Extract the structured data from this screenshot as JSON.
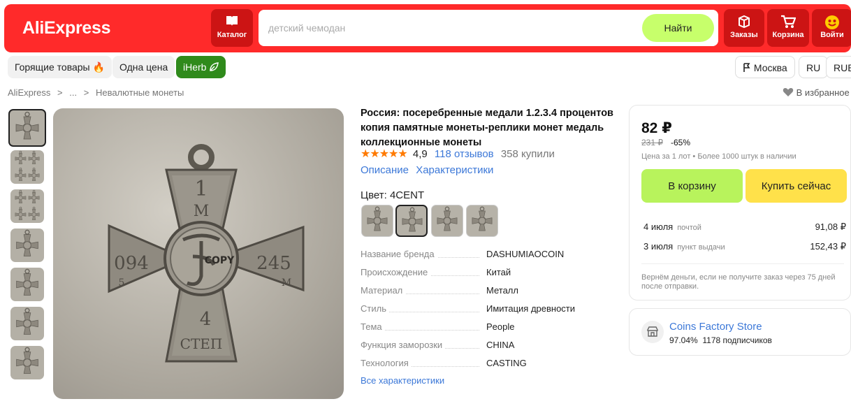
{
  "header": {
    "logo": "AliExpress",
    "catalog_label": "Каталог",
    "search_placeholder": "детский чемодан",
    "search_button": "Найти",
    "orders_label": "Заказы",
    "cart_label": "Корзина",
    "login_label": "Войти"
  },
  "nav": {
    "hot_deals": "Горящие товары",
    "one_price": "Одна цена",
    "iherb": "iHerb",
    "city": "Москва",
    "language": "RU",
    "currency": "RUB"
  },
  "breadcrumb": [
    "AliExpress",
    ">",
    "...",
    ">",
    "Невалютные монеты"
  ],
  "favorites_label": "В избранное",
  "product": {
    "title": "Россия: посеребренные медали 1.2.3.4 процентов копия памятные монеты-реплики монет медаль коллекционные монеты",
    "stars": "★★★★★",
    "rating": "4,9",
    "reviews": "118 отзывов",
    "bought": "358 купили",
    "tabs": [
      "Описание",
      "Характеристики"
    ],
    "color_label": "Цвет: 4CENT",
    "specs": [
      {
        "key": "Название бренда",
        "value": "DASHUMIAOCOIN"
      },
      {
        "key": "Происхождение",
        "value": "Китай"
      },
      {
        "key": "Материал",
        "value": "Металл"
      },
      {
        "key": "Стиль",
        "value": "Имитация древности"
      },
      {
        "key": "Тема",
        "value": "People"
      },
      {
        "key": "Функция заморозки",
        "value": "CHINA"
      },
      {
        "key": "Технология",
        "value": "CASTING"
      }
    ],
    "all_specs_link": "Все характеристики",
    "image_text": {
      "top": "1",
      "top2": "М",
      "left": "094",
      "left_small": "5",
      "right": "245",
      "right_small": "М",
      "bottom": "4",
      "bottom2": "СТЕП",
      "stamp": "COPY"
    }
  },
  "purchase": {
    "price": "82 ₽",
    "old_price": "231 ₽",
    "discount": "-65%",
    "lot_info": "Цена за 1 лот • Более 1000 штук в наличии",
    "cart_button": "В корзину",
    "buy_button": "Купить сейчас",
    "shipping": [
      {
        "date": "4 июля",
        "method": "почтой",
        "cost": "91,08 ₽"
      },
      {
        "date": "3 июля",
        "method": "пункт выдачи",
        "cost": "152,43 ₽"
      }
    ],
    "refund_note": "Вернём деньги, если не получите заказ через 75 дней после отправки."
  },
  "store": {
    "name": "Coins Factory Store",
    "rating": "97.04%",
    "followers": "1178 подписчиков"
  },
  "colors": {
    "header_bg": "#ff2a2a",
    "search_button": "#c7ff6b",
    "cart_button": "#b8f35c",
    "buy_button": "#ffe14a",
    "link": "#3c78d8",
    "stars": "#ff7a00",
    "iherb": "#2f8a1b"
  }
}
